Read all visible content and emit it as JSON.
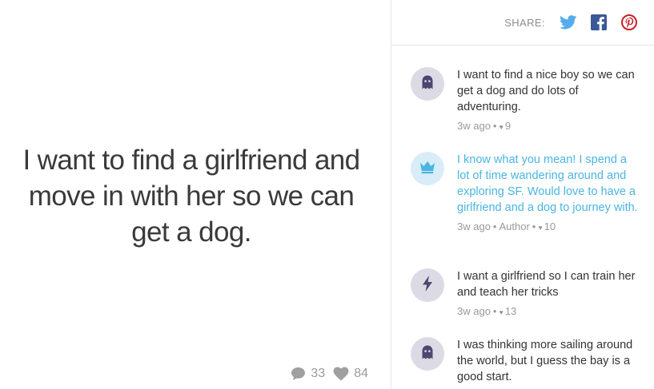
{
  "post": {
    "text": "I want to find a girlfriend and move in with her so we can get a dog.",
    "comments_count": "33",
    "likes_count": "84"
  },
  "share": {
    "label": "SHARE:",
    "icons": [
      "twitter-icon",
      "facebook-icon",
      "pinterest-icon"
    ]
  },
  "comments": [
    {
      "avatar": "ghost-icon",
      "text": "I want to find a nice boy so we can get a dog and do lots of adventuring.",
      "time": "3w ago",
      "tag": "",
      "likes": "9",
      "is_author": false
    },
    {
      "avatar": "crown-icon",
      "text": "I know what you mean! I spend a lot of time wandering around and exploring SF. Would love to have a girlfriend and a dog to journey with.",
      "time": "3w ago",
      "tag": "Author",
      "likes": "10",
      "is_author": true
    },
    {
      "avatar": "lightning-icon",
      "text": "I want a girlfriend so I can train her and teach her tricks",
      "time": "3w ago",
      "tag": "",
      "likes": "13",
      "is_author": false
    },
    {
      "avatar": "ghost-icon",
      "text": "I was thinking more sailing around the world, but I guess the bay is a good start.",
      "time": "",
      "tag": "",
      "likes": "",
      "is_author": false
    }
  ],
  "colors": {
    "twitter": "#55acee",
    "facebook": "#3b5998",
    "pinterest": "#cb2027",
    "author_text": "#4ab5e0",
    "avatar_icon": "#4a4870"
  }
}
